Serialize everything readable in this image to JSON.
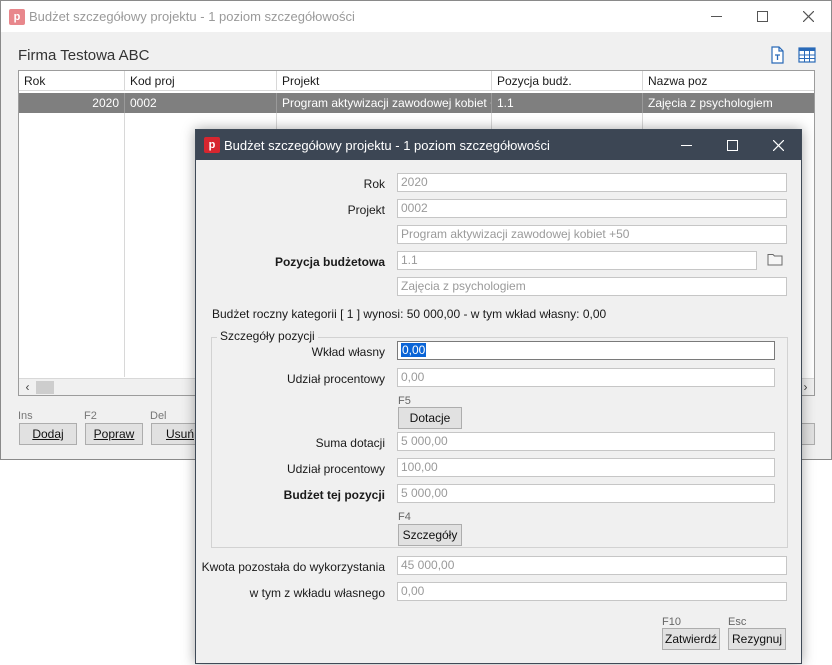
{
  "bg_window": {
    "title": "Budżet szczegółowy projektu - 1 poziom szczegółowości",
    "company": "Firma Testowa ABC",
    "columns": [
      "Rok",
      "Kod proj",
      "Projekt",
      "Pozycja budż.",
      "Nazwa poz"
    ],
    "row": [
      "2020",
      "0002",
      "Program aktywizacji zawodowej kobiet +50",
      "1.1",
      "Zajęcia z psychologiem"
    ],
    "hotkeys": {
      "add": "Ins",
      "edit": "F2",
      "delete": "Del"
    },
    "buttons": {
      "add": "Dodaj",
      "edit": "Popraw",
      "delete": "Usuń"
    },
    "icons": [
      "document-icon",
      "table-icon"
    ]
  },
  "dialog": {
    "title": "Budżet szczegółowy projektu - 1 poziom szczegółowości",
    "labels": {
      "year": "Rok",
      "project": "Projekt",
      "budget_position": "Pozycja budżetowa",
      "group": "Szczegóły pozycji",
      "own_contribution": "Wkład własny",
      "percent_share_1": "Udział procentowy",
      "grants_sum": "Suma dotacji",
      "percent_share_2": "Udział procentowy",
      "position_budget": "Budżet tej pozycji",
      "remaining": "Kwota pozostała do wykorzystania",
      "remaining_own": "w tym z wkładu własnego"
    },
    "values": {
      "year": "2020",
      "project_code": "0002",
      "project_name": "Program aktywizacji zawodowej kobiet +50",
      "position_code": "1.1",
      "position_name": "Zajęcia z psychologiem",
      "own_contribution": "0,00",
      "percent_share_1": "0,00",
      "grants_sum": "5 000,00",
      "percent_share_2": "100,00",
      "position_budget": "5 000,00",
      "remaining": "45 000,00",
      "remaining_own": "0,00"
    },
    "info_line": "Budżet roczny kategorii  [ 1 ]  wynosi: 50 000,00  -  w tym wkład własny: 0,00",
    "fkeys": {
      "grants": "F5",
      "details": "F4",
      "confirm": "F10",
      "cancel": "Esc"
    },
    "buttons": {
      "grants": "Dotacje",
      "details": "Szczegóły",
      "confirm": "Zatwierdź",
      "cancel": "Rezygnuj"
    }
  }
}
